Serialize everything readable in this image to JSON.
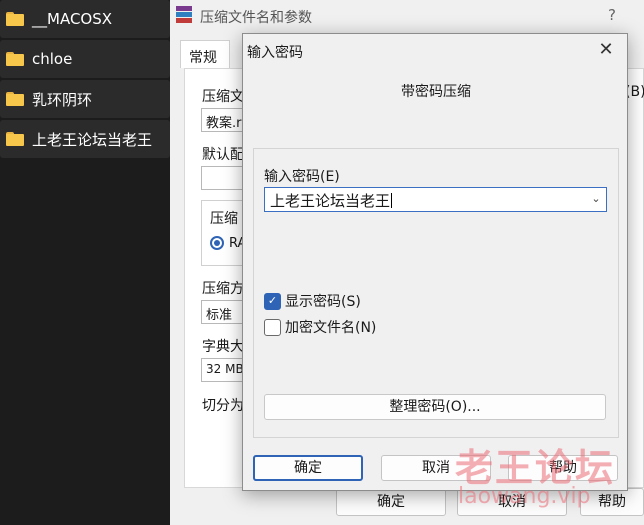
{
  "explorer": {
    "folders": [
      "__MACOSX",
      "chloe",
      "乳环阴环",
      "上老王论坛当老王"
    ]
  },
  "rar_dialog": {
    "title": "压缩文件名和参数",
    "help": "?",
    "tab_general": "常规",
    "archive_name_label": "压缩文",
    "archive_name_value": "教案.r",
    "browse_suffix": "(B)",
    "default_profile_label": "默认配",
    "format_group_label": "压缩",
    "format_rar": "RA",
    "method_label": "压缩方",
    "method_value": "标准",
    "dict_label": "字典大",
    "dict_value": "32 MB",
    "split_label": "切分为",
    "ok": "确定",
    "cancel": "取消",
    "help_btn": "帮助"
  },
  "password_dialog": {
    "title": "输入密码",
    "close": "✕",
    "heading": "带密码压缩",
    "enter_password_label": "输入密码(E)",
    "password_value": "上老王论坛当老王",
    "show_password": "显示密码(S)",
    "show_password_checked": true,
    "encrypt_filenames": "加密文件名(N)",
    "encrypt_filenames_checked": false,
    "organize_passwords": "整理密码(O)...",
    "ok": "确定",
    "cancel": "取消",
    "help": "帮助"
  },
  "watermark": {
    "text": "老王论坛",
    "url": "laowang.vip"
  },
  "colors": {
    "accent": "#2e63b5",
    "folder": "#f6c74a"
  }
}
